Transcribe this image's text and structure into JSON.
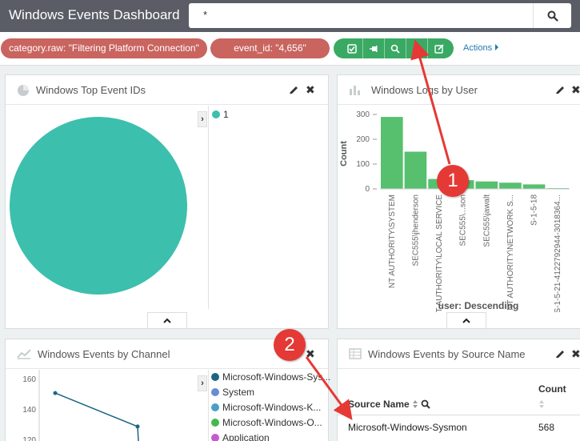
{
  "header": {
    "title": "Windows Events Dashboard",
    "query": "*"
  },
  "filters": {
    "pills": [
      {
        "label": "category.raw: \"Filtering Platform Connection\""
      },
      {
        "label": "event_id: \"4,656\""
      }
    ],
    "actions_label": "Actions"
  },
  "panels": {
    "top_event_ids": {
      "title": "Windows Top Event IDs",
      "legend": [
        {
          "label": "1",
          "color": "#3dbfad"
        }
      ]
    },
    "logs_by_user": {
      "title": "Windows Logs by User",
      "ylabel": "Count",
      "xlabel": "user: Descending",
      "yticks": [
        "300",
        "200",
        "100",
        "0"
      ],
      "xticks": [
        "NT AUTHORITY\\SYSTEM",
        "SEC555\\jhenderson",
        "NT AUTHORITY\\LOCAL SERVICE",
        "SEC555\\...son",
        "SEC555\\jawalt",
        "NT AUTHORITY\\NETWORK S...",
        "S-1-5-18",
        "S-1-5-21-4122792944-3018364..."
      ]
    },
    "events_by_channel": {
      "title": "Windows Events by Channel",
      "yticks": [
        "160",
        "140",
        "120"
      ],
      "legend": [
        {
          "label": "Microsoft-Windows-Sys...",
          "color": "#1a6680"
        },
        {
          "label": "System",
          "color": "#6b8ad6"
        },
        {
          "label": "Microsoft-Windows-K...",
          "color": "#4a9fc9"
        },
        {
          "label": "Microsoft-Windows-O...",
          "color": "#45b84f"
        },
        {
          "label": "Application",
          "color": "#c45ad1"
        }
      ]
    },
    "events_by_source": {
      "title": "Windows Events by Source Name",
      "columns": {
        "name": "Source Name",
        "count": "Count"
      },
      "rows": [
        {
          "name": "Microsoft-Windows-Sysmon",
          "count": "568"
        }
      ]
    }
  },
  "annotations": {
    "callout_1": "1",
    "callout_2": "2"
  },
  "chart_data": [
    {
      "type": "pie",
      "title": "Windows Top Event IDs",
      "categories": [
        "1"
      ],
      "values": [
        100
      ],
      "colors": [
        "#3dbfad"
      ]
    },
    {
      "type": "bar",
      "title": "Windows Logs by User",
      "xlabel": "user: Descending",
      "ylabel": "Count",
      "ylim": [
        0,
        300
      ],
      "categories": [
        "NT AUTHORITY\\SYSTEM",
        "SEC555\\jhenderson",
        "NT AUTHORITY\\LOCAL SERVICE",
        "SEC555\\...son",
        "SEC555\\jawalt",
        "NT AUTHORITY\\NETWORK S...",
        "S-1-5-18",
        "S-1-5-21-4122792944-3018364..."
      ],
      "values": [
        290,
        150,
        40,
        35,
        30,
        25,
        18,
        3
      ],
      "color": "#56c06e"
    },
    {
      "type": "line",
      "title": "Windows Events by Channel",
      "ylim": [
        115,
        160
      ],
      "series": [
        {
          "name": "Microsoft-Windows-Sys...",
          "values": [
            151,
            129,
            110
          ]
        }
      ]
    }
  ]
}
